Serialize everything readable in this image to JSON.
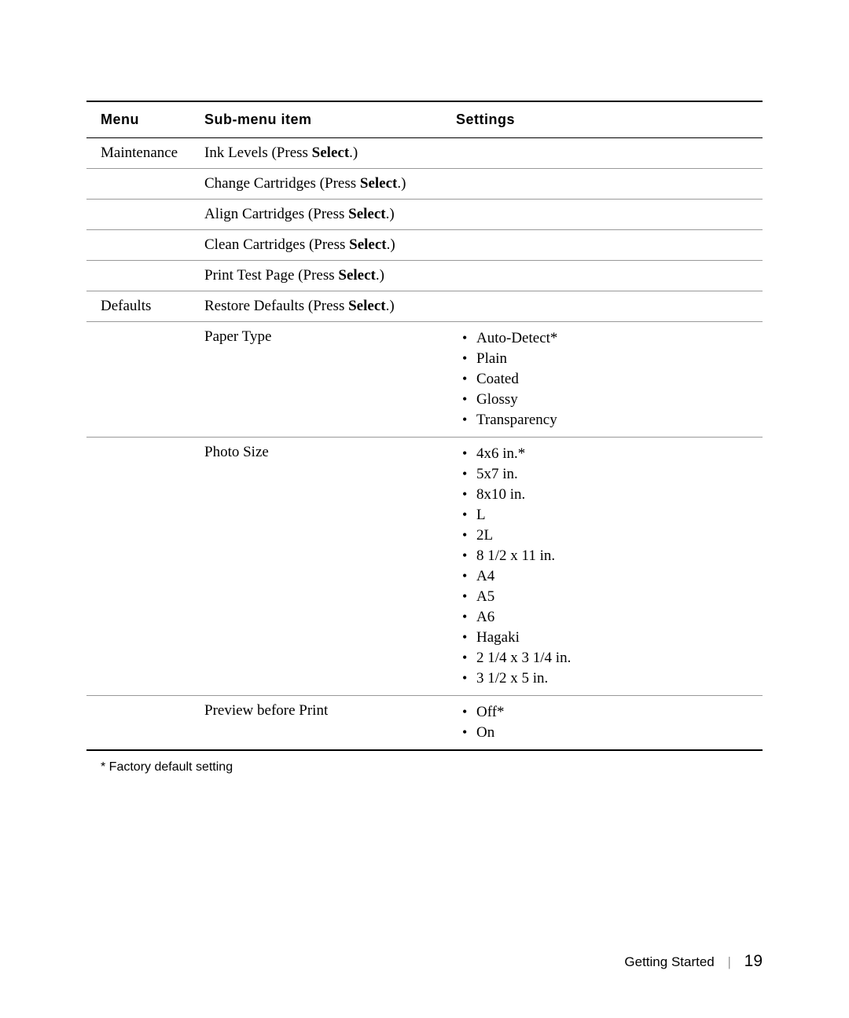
{
  "headers": {
    "menu": "Menu",
    "sub": "Sub-menu item",
    "settings": "Settings"
  },
  "rows": [
    {
      "menu": "Maintenance",
      "sub_prefix": "Ink Levels (Press ",
      "sub_bold": "Select",
      "sub_suffix": ".)",
      "settings": []
    },
    {
      "menu": "",
      "sub_prefix": "Change Cartridges (Press ",
      "sub_bold": "Select",
      "sub_suffix": ".)",
      "settings": []
    },
    {
      "menu": "",
      "sub_prefix": "Align Cartridges (Press ",
      "sub_bold": "Select",
      "sub_suffix": ".)",
      "settings": []
    },
    {
      "menu": "",
      "sub_prefix": "Clean Cartridges (Press ",
      "sub_bold": "Select",
      "sub_suffix": ".)",
      "settings": []
    },
    {
      "menu": "",
      "sub_prefix": "Print Test Page (Press ",
      "sub_bold": "Select",
      "sub_suffix": ".)",
      "settings": []
    },
    {
      "menu": "Defaults",
      "sub_prefix": "Restore Defaults (Press ",
      "sub_bold": "Select",
      "sub_suffix": ".)",
      "settings": []
    },
    {
      "menu": "",
      "sub_plain": "Paper Type",
      "settings": [
        "Auto-Detect*",
        "Plain",
        "Coated",
        "Glossy",
        "Transparency"
      ]
    },
    {
      "menu": "",
      "sub_plain": "Photo Size",
      "settings": [
        "4x6 in.*",
        "5x7 in.",
        "8x10 in.",
        "L",
        "2L",
        "8 1/2 x 11 in.",
        "A4",
        "A5",
        "A6",
        "Hagaki",
        "2 1/4 x 3 1/4 in.",
        "3 1/2 x 5 in."
      ]
    },
    {
      "menu": "",
      "sub_plain": "Preview before Print",
      "settings": [
        "Off*",
        "On"
      ],
      "heavy": true
    }
  ],
  "footnote": "* Factory default setting",
  "footer": {
    "section": "Getting Started",
    "page": "19"
  }
}
